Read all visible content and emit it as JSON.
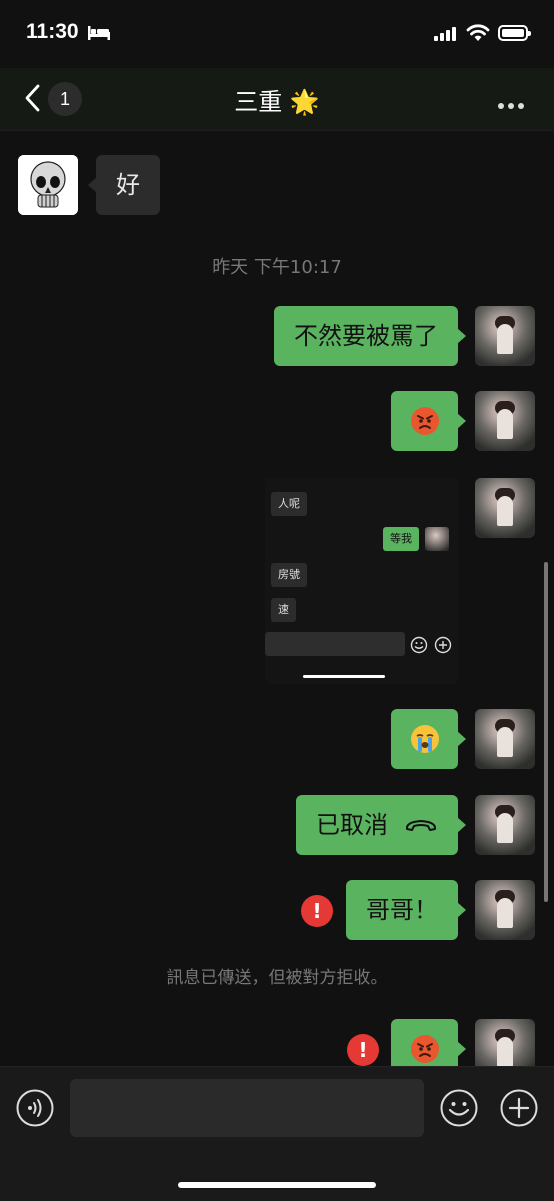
{
  "status_bar": {
    "time": "11:30"
  },
  "nav": {
    "back_badge": "1",
    "title": "三重 🌟"
  },
  "messages": {
    "theirs_1": "好",
    "timestamp": "昨天 下午10:17",
    "mine_1": "不然要被罵了",
    "mine_2_emoji": "pouting-face-emoji",
    "mine_4_emoji": "crying-face-emoji",
    "mine_5": "已取消",
    "mine_6": "哥哥！",
    "system_note": "訊息已傳送，但被對方拒收。",
    "mine_7_emoji": "pouting-face-emoji",
    "error_mark": "!"
  },
  "screenshot_message": {
    "messages": [
      "人呢",
      "等我",
      "房號",
      "速"
    ]
  },
  "colors": {
    "bubble_mine": "#5ab35f",
    "bubble_theirs": "#2c2c2c",
    "error": "#e53935",
    "background": "#111111"
  }
}
